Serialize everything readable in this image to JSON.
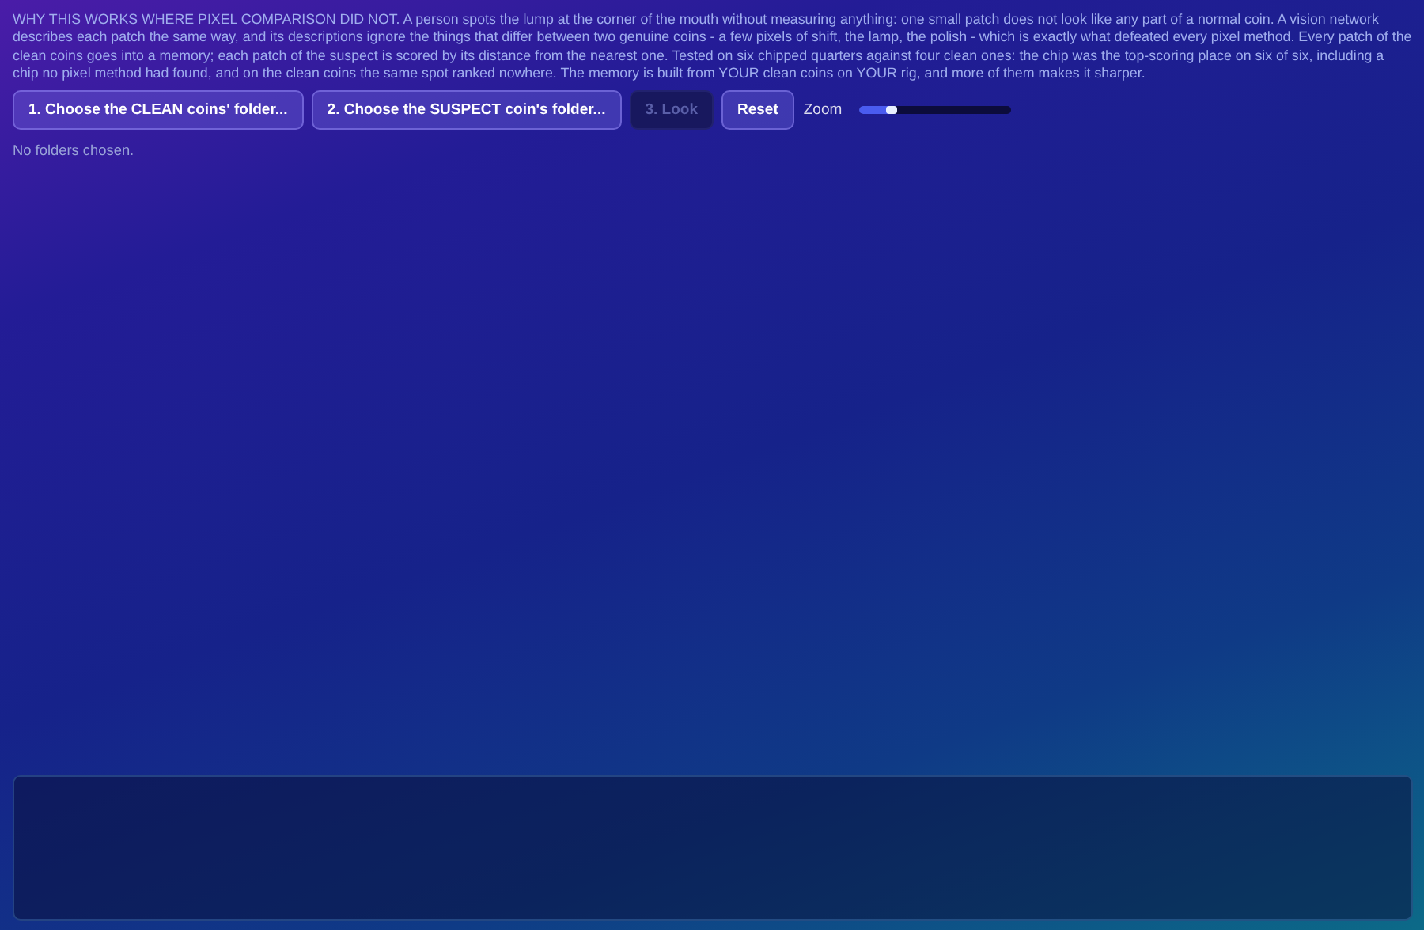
{
  "intro": "WHY THIS WORKS WHERE PIXEL COMPARISON DID NOT. A person spots the lump at the corner of the mouth without measuring anything: one small patch does not look like any part of a normal coin. A vision network describes each patch the same way, and its descriptions ignore the things that differ between two genuine coins - a few pixels of shift, the lamp, the polish - which is exactly what defeated every pixel method. Every patch of the clean coins goes into a memory; each patch of the suspect is scored by its distance from the nearest one. Tested on six chipped quarters against four clean ones: the chip was the top-scoring place on six of six, including a chip no pixel method had found, and on the clean coins the same spot ranked nowhere. The memory is built from YOUR clean coins on YOUR rig, and more of them makes it sharper.",
  "buttons": [
    {
      "label": "1. Choose the CLEAN coins' folder...",
      "disabled": false
    },
    {
      "label": "2. Choose the SUSPECT coin's folder...",
      "disabled": false
    },
    {
      "label": "3. Look",
      "disabled": true
    },
    {
      "label": "Reset",
      "disabled": false
    }
  ],
  "zoom": {
    "label": "Zoom",
    "level": 0.25
  },
  "status": "No folders chosen."
}
